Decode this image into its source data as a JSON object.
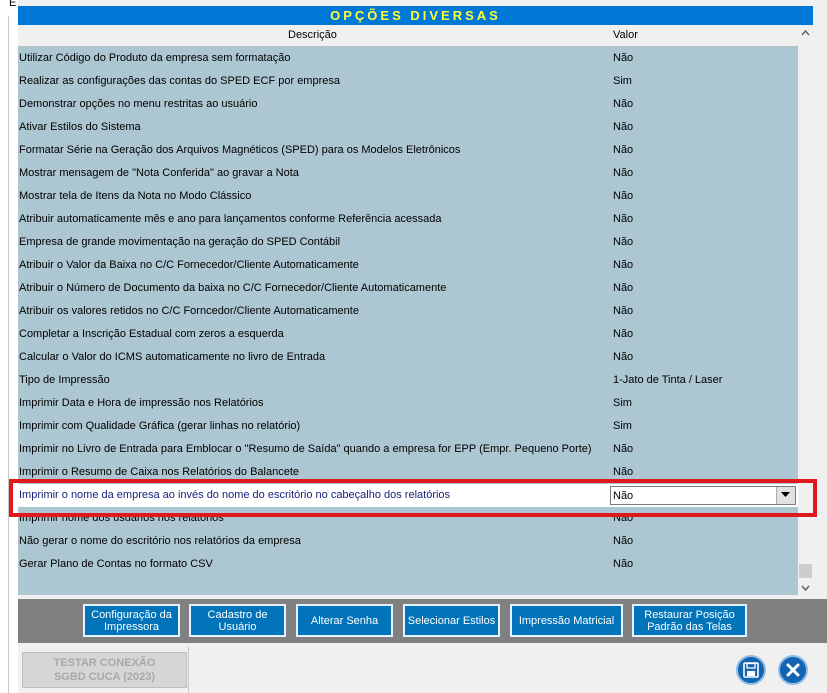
{
  "window": {
    "left_char": "E",
    "title": "OPÇÕES DIVERSAS"
  },
  "grid": {
    "columns": {
      "description": "Descrição",
      "value": "Valor"
    },
    "rows": [
      {
        "description": "Utilizar Código do Produto da empresa sem formatação",
        "value": "Não"
      },
      {
        "description": "Realizar as configurações das contas do SPED ECF por empresa",
        "value": "Sim"
      },
      {
        "description": "Demonstrar opções no menu restritas ao usuário",
        "value": "Não"
      },
      {
        "description": "Ativar Estilos do Sistema",
        "value": "Não"
      },
      {
        "description": "Formatar Série na Geração dos Arquivos Magnéticos (SPED) para os Modelos Eletrônicos",
        "value": "Não"
      },
      {
        "description": "Mostrar mensagem de \"Nota Conferida\" ao gravar a Nota",
        "value": "Não"
      },
      {
        "description": "Mostrar tela de Itens da Nota no Modo Clássico",
        "value": "Não"
      },
      {
        "description": "Atribuir automaticamente mês e ano para lançamentos conforme Referência acessada",
        "value": "Não"
      },
      {
        "description": "Empresa de grande movimentação na geração do SPED Contábil",
        "value": "Não"
      },
      {
        "description": "Atribuir o Valor da Baixa no C/C Fornecedor/Cliente Automaticamente",
        "value": "Não"
      },
      {
        "description": "Atribuir o Número de Documento da baixa no C/C Fornecedor/Cliente Automaticamente",
        "value": "Não"
      },
      {
        "description": "Atribuir os valores retidos no C/C Forncedor/Cliente Automaticamente",
        "value": "Não"
      },
      {
        "description": "Completar a Inscrição Estadual com zeros a esquerda",
        "value": "Não"
      },
      {
        "description": "Calcular o Valor do ICMS automaticamente no livro de Entrada",
        "value": "Não"
      },
      {
        "description": "Tipo de Impressão",
        "value": "1-Jato de Tinta / Laser"
      },
      {
        "description": "Imprimir Data e Hora de impressão nos Relatórios",
        "value": "Sim"
      },
      {
        "description": "Imprimir com Qualidade Gráfica (gerar linhas no relatório)",
        "value": "Sim"
      },
      {
        "description": "Imprimir no Livro de Entrada para Emblocar o \"Resumo de Saída\" quando a empresa for EPP (Empr. Pequeno Porte)",
        "value": "Não"
      },
      {
        "description": "Imprimir o Resumo de Caixa nos Relatórios do Balancete",
        "value": "Não"
      }
    ],
    "selected_row": {
      "description": "Imprimir o nome da empresa ao invés do nome do escritório no cabeçalho dos relatórios",
      "value": "Não"
    },
    "rows_after": [
      {
        "description": "Imprimir nome dos usuários nos relatórios",
        "value": "Não"
      },
      {
        "description": "Não gerar o nome do escritório nos relatórios da empresa",
        "value": "Não"
      },
      {
        "description": "Gerar Plano de Contas no formato CSV",
        "value": "Não"
      }
    ]
  },
  "toolbar": {
    "buttons": [
      {
        "label": "Configuração da Impressora"
      },
      {
        "label": "Cadastro de Usuário"
      },
      {
        "label": "Alterar Senha"
      },
      {
        "label": "Selecionar Estilos"
      },
      {
        "label": "Impressão Matricial"
      },
      {
        "label": "Restaurar Posição Padrão das Telas"
      }
    ]
  },
  "footer": {
    "test_button_line1": "TESTAR CONEXÃO",
    "test_button_line2": "SGBD CUCA (2023)",
    "save_icon": "floppy-disk-icon",
    "close_icon": "close-x-icon"
  },
  "colors": {
    "title_bg": "#0078d7",
    "title_text": "#ffff33",
    "grid_bg": "#acc7d2",
    "highlight": "#e0191f",
    "button_bg": "#0073b9"
  }
}
